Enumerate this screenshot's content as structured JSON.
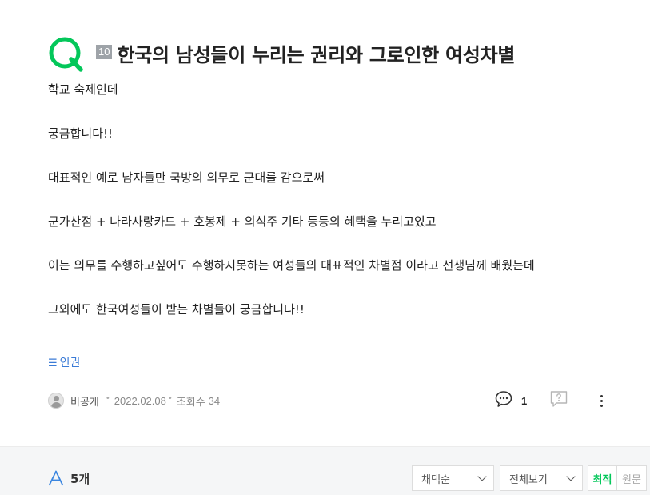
{
  "question": {
    "level_badge": "10",
    "title": "한국의 남성들이 누리는 권리와 그로인한 여성차별",
    "body": [
      "학교 숙제인데",
      "궁금합니다!!",
      "대표적인 예로 남자들만  국방의 의무로 군대를 감으로써",
      "군가산점 + 나라사랑카드 + 호봉제 + 의식주 기타 등등의 혜택을 누리고있고",
      "이는 의무를 수행하고싶어도 수행하지못하는 여성들의 대표적인 차별점 이라고 선생님께 배웠는데",
      "그외에도 한국여성들이 받는 차별들이 궁금합니다!!"
    ],
    "tag_icon": "☰",
    "tag": "인권",
    "author": "비공개",
    "date": "2022.02.08",
    "views_label": "조회수",
    "views": "34",
    "comment_count": "1",
    "icons": {
      "q_mark": "q-mark-icon",
      "comment": "comment-icon",
      "report": "report-icon",
      "more": "more-icon"
    },
    "accent_color": "#03c75a"
  },
  "answers": {
    "count_label": "5개",
    "sort_select": "채택순",
    "view_select": "전체보기",
    "toggle_latest": "최적",
    "toggle_original": "원문"
  }
}
